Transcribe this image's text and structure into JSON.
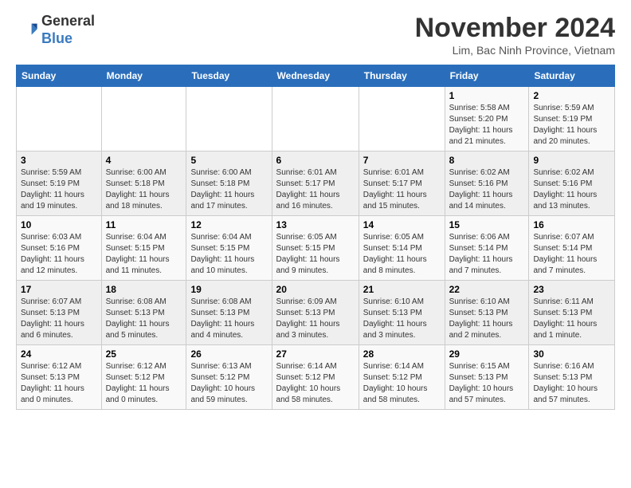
{
  "logo": {
    "general": "General",
    "blue": "Blue"
  },
  "header": {
    "month": "November 2024",
    "location": "Lim, Bac Ninh Province, Vietnam"
  },
  "weekdays": [
    "Sunday",
    "Monday",
    "Tuesday",
    "Wednesday",
    "Thursday",
    "Friday",
    "Saturday"
  ],
  "weeks": [
    [
      {
        "day": "",
        "info": ""
      },
      {
        "day": "",
        "info": ""
      },
      {
        "day": "",
        "info": ""
      },
      {
        "day": "",
        "info": ""
      },
      {
        "day": "",
        "info": ""
      },
      {
        "day": "1",
        "info": "Sunrise: 5:58 AM\nSunset: 5:20 PM\nDaylight: 11 hours and 21 minutes."
      },
      {
        "day": "2",
        "info": "Sunrise: 5:59 AM\nSunset: 5:19 PM\nDaylight: 11 hours and 20 minutes."
      }
    ],
    [
      {
        "day": "3",
        "info": "Sunrise: 5:59 AM\nSunset: 5:19 PM\nDaylight: 11 hours and 19 minutes."
      },
      {
        "day": "4",
        "info": "Sunrise: 6:00 AM\nSunset: 5:18 PM\nDaylight: 11 hours and 18 minutes."
      },
      {
        "day": "5",
        "info": "Sunrise: 6:00 AM\nSunset: 5:18 PM\nDaylight: 11 hours and 17 minutes."
      },
      {
        "day": "6",
        "info": "Sunrise: 6:01 AM\nSunset: 5:17 PM\nDaylight: 11 hours and 16 minutes."
      },
      {
        "day": "7",
        "info": "Sunrise: 6:01 AM\nSunset: 5:17 PM\nDaylight: 11 hours and 15 minutes."
      },
      {
        "day": "8",
        "info": "Sunrise: 6:02 AM\nSunset: 5:16 PM\nDaylight: 11 hours and 14 minutes."
      },
      {
        "day": "9",
        "info": "Sunrise: 6:02 AM\nSunset: 5:16 PM\nDaylight: 11 hours and 13 minutes."
      }
    ],
    [
      {
        "day": "10",
        "info": "Sunrise: 6:03 AM\nSunset: 5:16 PM\nDaylight: 11 hours and 12 minutes."
      },
      {
        "day": "11",
        "info": "Sunrise: 6:04 AM\nSunset: 5:15 PM\nDaylight: 11 hours and 11 minutes."
      },
      {
        "day": "12",
        "info": "Sunrise: 6:04 AM\nSunset: 5:15 PM\nDaylight: 11 hours and 10 minutes."
      },
      {
        "day": "13",
        "info": "Sunrise: 6:05 AM\nSunset: 5:15 PM\nDaylight: 11 hours and 9 minutes."
      },
      {
        "day": "14",
        "info": "Sunrise: 6:05 AM\nSunset: 5:14 PM\nDaylight: 11 hours and 8 minutes."
      },
      {
        "day": "15",
        "info": "Sunrise: 6:06 AM\nSunset: 5:14 PM\nDaylight: 11 hours and 7 minutes."
      },
      {
        "day": "16",
        "info": "Sunrise: 6:07 AM\nSunset: 5:14 PM\nDaylight: 11 hours and 7 minutes."
      }
    ],
    [
      {
        "day": "17",
        "info": "Sunrise: 6:07 AM\nSunset: 5:13 PM\nDaylight: 11 hours and 6 minutes."
      },
      {
        "day": "18",
        "info": "Sunrise: 6:08 AM\nSunset: 5:13 PM\nDaylight: 11 hours and 5 minutes."
      },
      {
        "day": "19",
        "info": "Sunrise: 6:08 AM\nSunset: 5:13 PM\nDaylight: 11 hours and 4 minutes."
      },
      {
        "day": "20",
        "info": "Sunrise: 6:09 AM\nSunset: 5:13 PM\nDaylight: 11 hours and 3 minutes."
      },
      {
        "day": "21",
        "info": "Sunrise: 6:10 AM\nSunset: 5:13 PM\nDaylight: 11 hours and 3 minutes."
      },
      {
        "day": "22",
        "info": "Sunrise: 6:10 AM\nSunset: 5:13 PM\nDaylight: 11 hours and 2 minutes."
      },
      {
        "day": "23",
        "info": "Sunrise: 6:11 AM\nSunset: 5:13 PM\nDaylight: 11 hours and 1 minute."
      }
    ],
    [
      {
        "day": "24",
        "info": "Sunrise: 6:12 AM\nSunset: 5:13 PM\nDaylight: 11 hours and 0 minutes."
      },
      {
        "day": "25",
        "info": "Sunrise: 6:12 AM\nSunset: 5:12 PM\nDaylight: 11 hours and 0 minutes."
      },
      {
        "day": "26",
        "info": "Sunrise: 6:13 AM\nSunset: 5:12 PM\nDaylight: 10 hours and 59 minutes."
      },
      {
        "day": "27",
        "info": "Sunrise: 6:14 AM\nSunset: 5:12 PM\nDaylight: 10 hours and 58 minutes."
      },
      {
        "day": "28",
        "info": "Sunrise: 6:14 AM\nSunset: 5:12 PM\nDaylight: 10 hours and 58 minutes."
      },
      {
        "day": "29",
        "info": "Sunrise: 6:15 AM\nSunset: 5:13 PM\nDaylight: 10 hours and 57 minutes."
      },
      {
        "day": "30",
        "info": "Sunrise: 6:16 AM\nSunset: 5:13 PM\nDaylight: 10 hours and 57 minutes."
      }
    ]
  ]
}
